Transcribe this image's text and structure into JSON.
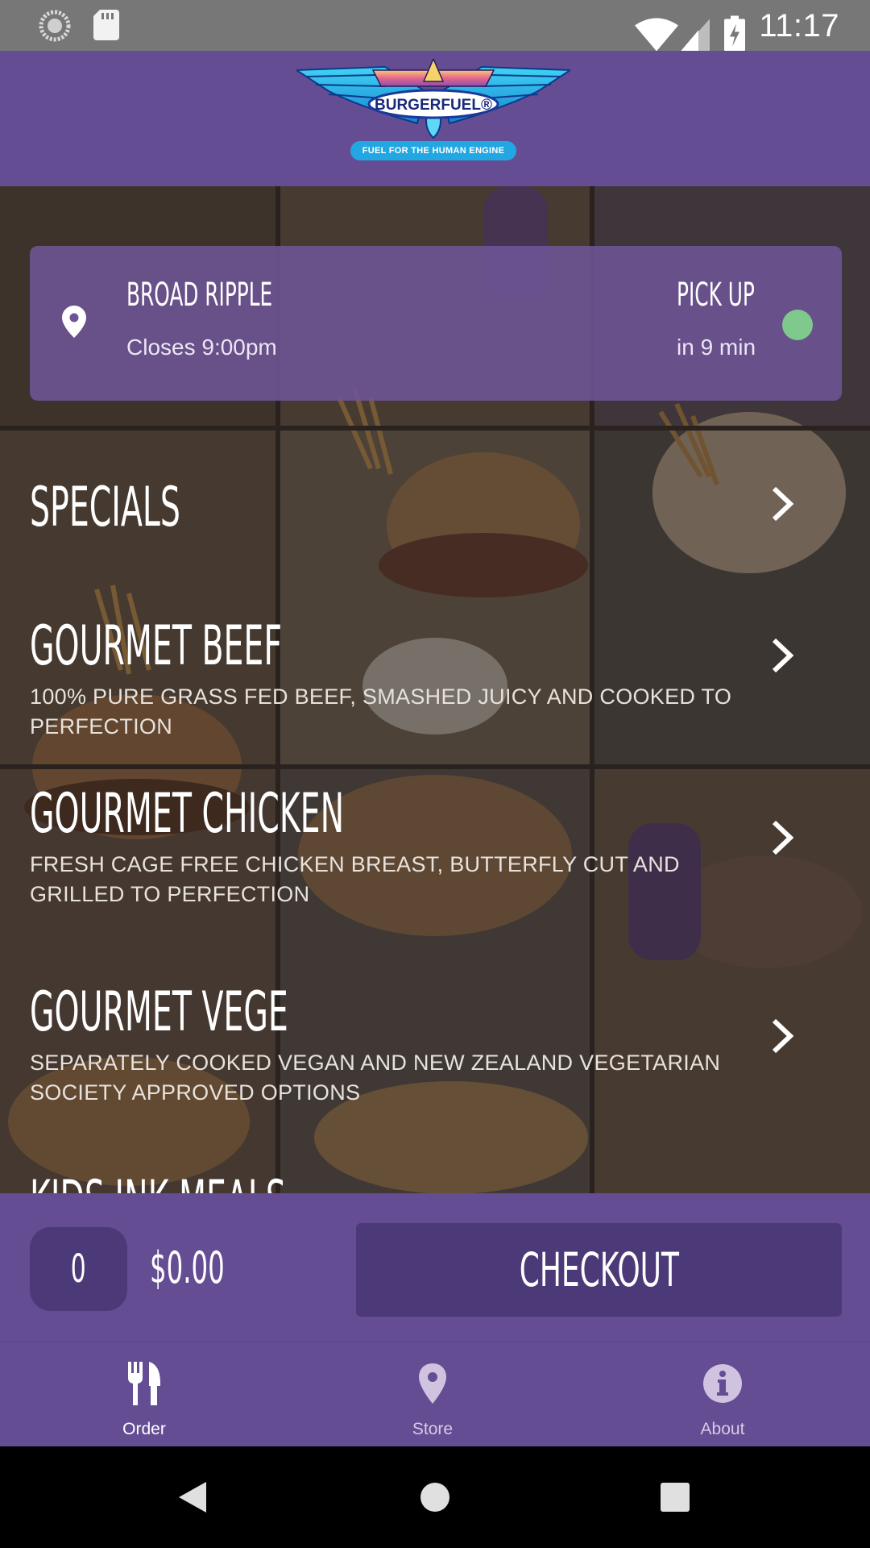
{
  "status_bar": {
    "time": "11:17",
    "left_icons": [
      "sync-icon",
      "sd-card-icon"
    ],
    "right_icons": [
      "wifi-icon",
      "cell-signal-icon",
      "battery-charging-icon"
    ]
  },
  "header": {
    "logo_text": "BURGERFUEL®",
    "logo_tagline": "FUEL FOR THE HUMAN ENGINE",
    "background_color": "#644d93"
  },
  "store": {
    "name": "BROAD RIPPLE",
    "hours": "Closes 9:00pm",
    "pickup_label": "PICK UP",
    "pickup_time": "in 9 min",
    "status_color": "#7ec98b",
    "icon": "location-pin-icon"
  },
  "menu": {
    "items": [
      {
        "title": "SPECIALS",
        "description": ""
      },
      {
        "title": "GOURMET BEEF",
        "description": "100% PURE GRASS FED BEEF, SMASHED JUICY AND COOKED TO PERFECTION"
      },
      {
        "title": "GOURMET CHICKEN",
        "description": "FRESH CAGE FREE CHICKEN BREAST, BUTTERFLY CUT AND GRILLED TO PERFECTION"
      },
      {
        "title": "GOURMET VEGE",
        "description": "SEPARATELY COOKED VEGAN AND NEW ZEALAND VEGETARIAN SOCIETY APPROVED OPTIONS"
      },
      {
        "title": "KIDS INK MEALS",
        "description": ""
      }
    ]
  },
  "cart": {
    "count": "0",
    "total": "$0.00",
    "checkout_label": "CHECKOUT"
  },
  "bottom_nav": {
    "items": [
      {
        "label": "Order",
        "icon": "utensils-icon",
        "active": true
      },
      {
        "label": "Store",
        "icon": "location-pin-icon",
        "active": false
      },
      {
        "label": "About",
        "icon": "info-icon",
        "active": false
      }
    ]
  },
  "system_nav": {
    "buttons": [
      "back-icon",
      "home-icon",
      "recents-icon"
    ]
  },
  "colors": {
    "brand_purple": "#644d93",
    "dark_purple": "#4c3a78",
    "pickup_status_green": "#7ec98b"
  }
}
